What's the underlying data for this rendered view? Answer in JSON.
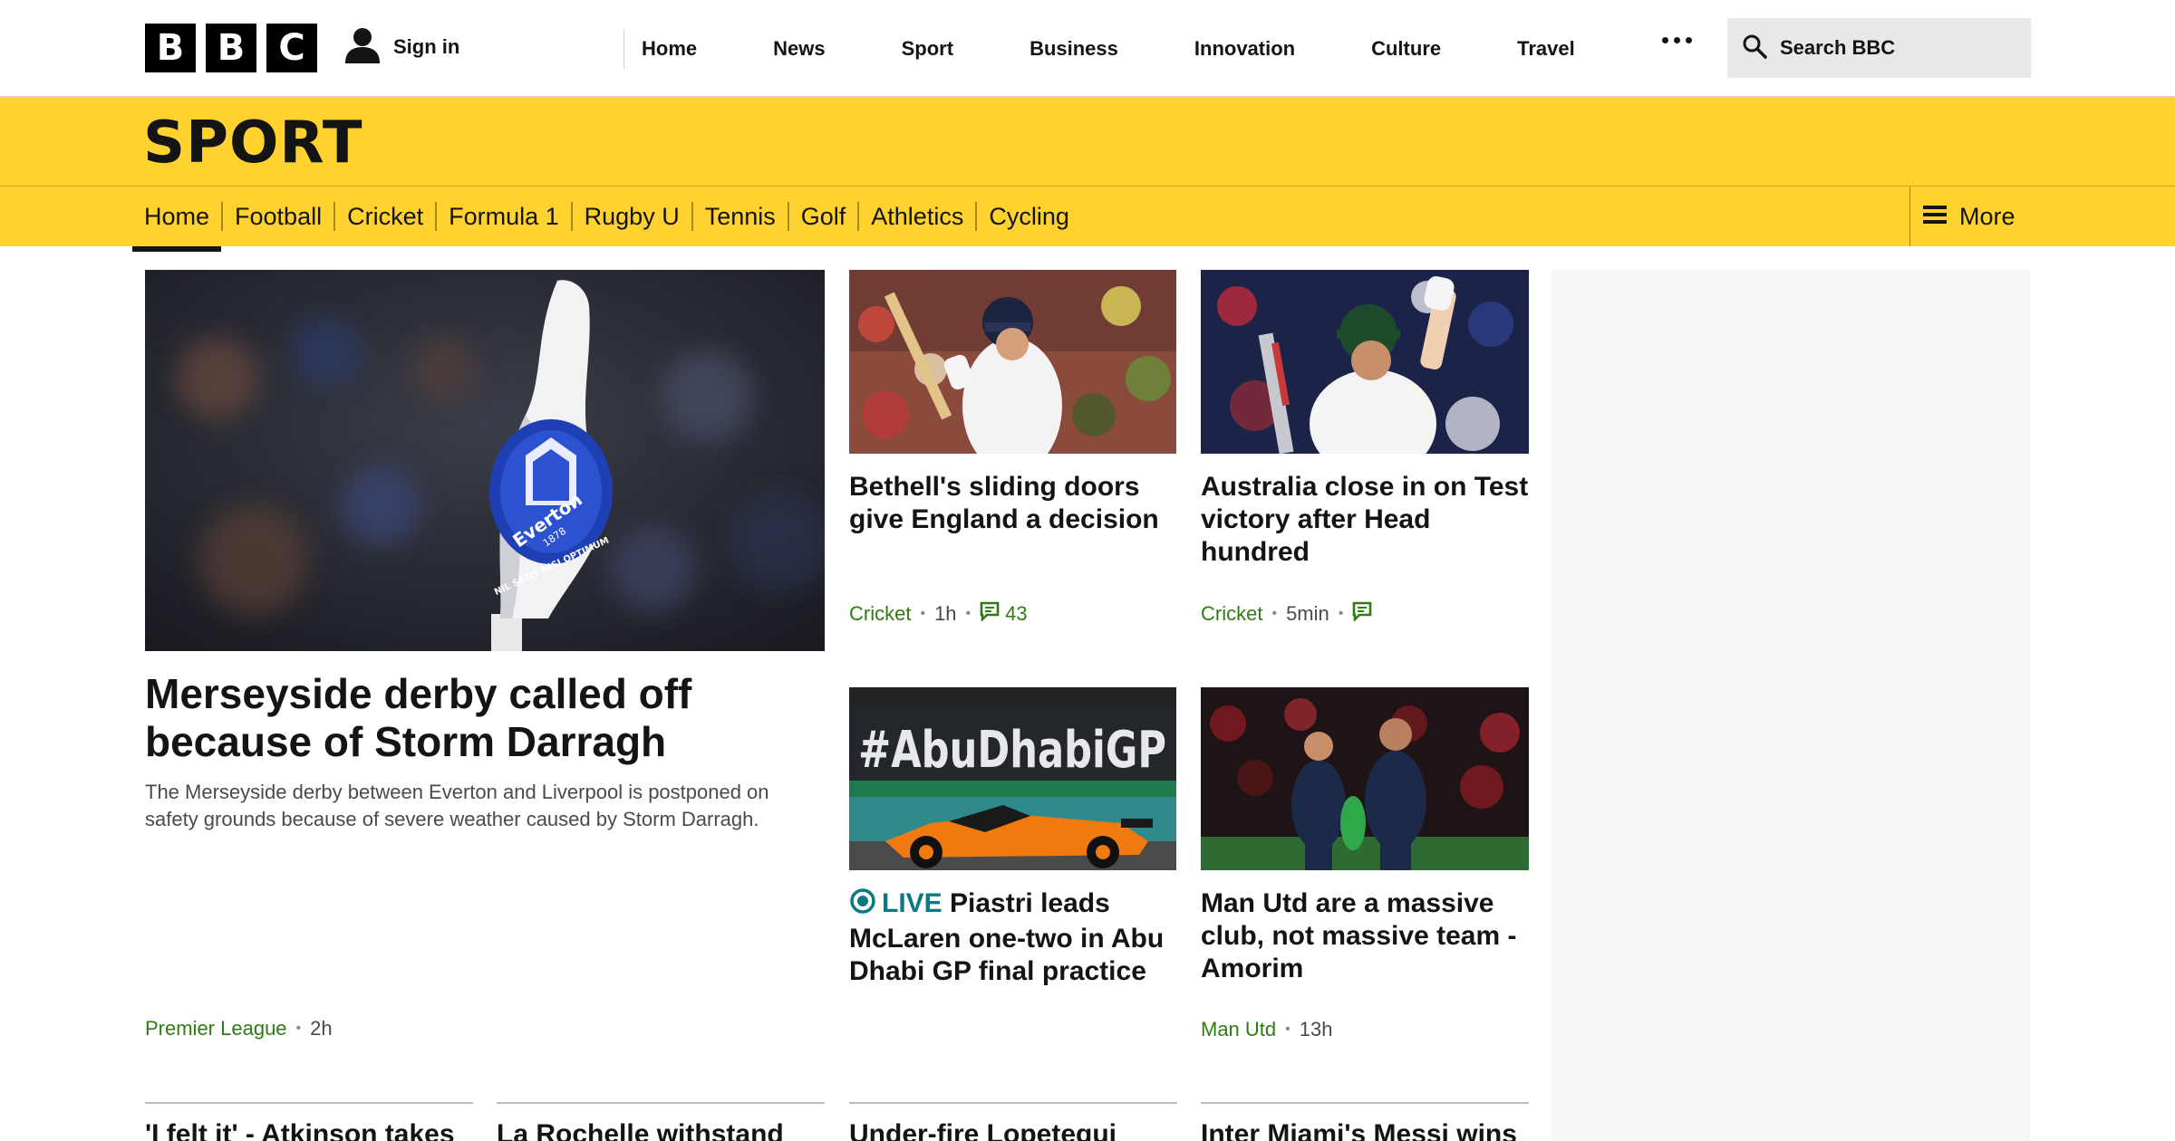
{
  "header": {
    "logo_letters": [
      "B",
      "B",
      "C"
    ],
    "sign_in": "Sign in",
    "nav": [
      "Home",
      "News",
      "Sport",
      "Business",
      "Innovation",
      "Culture",
      "Travel"
    ],
    "search_placeholder": "Search BBC"
  },
  "sport": {
    "title": "SPORT",
    "tabs": [
      "Home",
      "Football",
      "Cricket",
      "Formula 1",
      "Rugby U",
      "Tennis",
      "Golf",
      "Athletics",
      "Cycling"
    ],
    "active_tab": "Home",
    "more_label": "More"
  },
  "lead": {
    "headline": "Merseyside derby called off because of Storm Darragh",
    "summary": "The Merseyside derby between Everton and Liverpool is postponed on safety grounds because of severe weather caused by Storm Darragh.",
    "tag": "Premier League",
    "time": "2h",
    "image_alt": "Everton corner flag"
  },
  "stories": [
    {
      "headline": "Bethell's sliding doors give England a decision",
      "tag": "Cricket",
      "time": "1h",
      "comments": "43"
    },
    {
      "headline": "Australia close in on Test victory after Head hundred",
      "tag": "Cricket",
      "time": "5min",
      "comments": ""
    },
    {
      "live_label": "LIVE",
      "headline": "Piastri leads McLaren one-two in Abu Dhabi GP final practice"
    },
    {
      "headline": "Man Utd are a massive club, not massive team - Amorim",
      "tag": "Man Utd",
      "time": "13h"
    }
  ],
  "image_text": {
    "everton_crest": "Everton",
    "everton_year": "1878",
    "everton_motto": "NIL SATIS NISI OPTIMUM",
    "abu_dhabi_banner": "#AbuDhabiGP"
  },
  "bottom_row": [
    "'I felt it' - Atkinson takes",
    "La Rochelle withstand",
    "Under-fire Lopetegui",
    "Inter Miami's Messi wins"
  ],
  "colors": {
    "sport_yellow": "#ffd230",
    "tag_green": "#2e7d11",
    "live_teal": "#0a7a82"
  }
}
